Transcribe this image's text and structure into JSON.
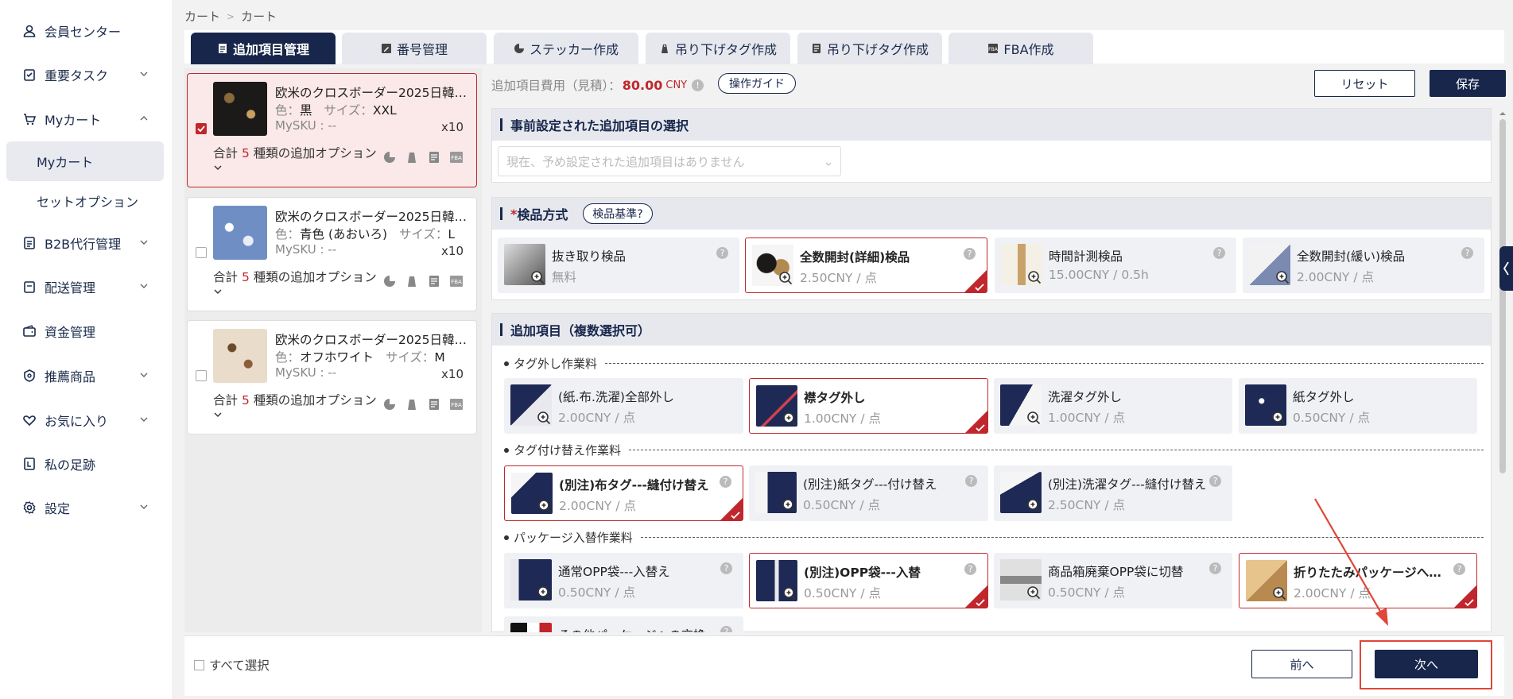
{
  "sidebar": {
    "items": [
      {
        "label": "会員センター",
        "icon": "user-icon",
        "chevron": false
      },
      {
        "label": "重要タスク",
        "icon": "task-icon",
        "chevron": true
      },
      {
        "label": "Myカート",
        "icon": "cart-icon",
        "chevron": true
      },
      {
        "label": "B2B代行管理",
        "icon": "document-icon",
        "chevron": true
      },
      {
        "label": "配送管理",
        "icon": "delivery-icon",
        "chevron": true
      },
      {
        "label": "資金管理",
        "icon": "wallet-icon",
        "chevron": false
      },
      {
        "label": "推薦商品",
        "icon": "recommend-icon",
        "chevron": true
      },
      {
        "label": "お気に入り",
        "icon": "heart-icon",
        "chevron": true
      },
      {
        "label": "私の足跡",
        "icon": "footprint-icon",
        "chevron": false
      },
      {
        "label": "設定",
        "icon": "gear-icon",
        "chevron": true
      }
    ],
    "subitems": [
      {
        "label": "Myカート",
        "active": true
      },
      {
        "label": "セットオプション",
        "active": false
      }
    ]
  },
  "breadcrumb": {
    "root": "カート",
    "current": "カート",
    "separator": ">"
  },
  "tabs": [
    {
      "label": "追加項目管理",
      "active": true
    },
    {
      "label": "番号管理",
      "active": false
    },
    {
      "label": "ステッカー作成",
      "active": false
    },
    {
      "label": "吊り下げタグ作成",
      "active": false
    },
    {
      "label": "吊り下げタグ作成",
      "active": false
    },
    {
      "label": "FBA作成",
      "active": false
    }
  ],
  "products": [
    {
      "title": "欧米のクロスボーダー2025日韓…",
      "color_label": "色：",
      "color": "黒",
      "size_label": "サイズ：",
      "size": "XXL",
      "sku": "MySKU : --",
      "qty": "x10",
      "options_prefix": "合計",
      "options_count": "5",
      "options_suffix": "種類の追加オプション",
      "checked": true
    },
    {
      "title": "欧米のクロスボーダー2025日韓…",
      "color_label": "色：",
      "color": "青色 (あおいろ)",
      "size_label": "サイズ：",
      "size": "L",
      "sku": "MySKU : --",
      "qty": "x10",
      "options_prefix": "合計",
      "options_count": "5",
      "options_suffix": "種類の追加オプション",
      "checked": false
    },
    {
      "title": "欧米のクロスボーダー2025日韓…",
      "color_label": "色：",
      "color": "オフホワイト",
      "size_label": "サイズ：",
      "size": "M",
      "sku": "MySKU : --",
      "qty": "x10",
      "options_prefix": "合計",
      "options_count": "5",
      "options_suffix": "種類の追加オプション",
      "checked": false
    }
  ],
  "fee": {
    "label": "追加項目費用（見積）：",
    "amount": "80.00",
    "currency": "CNY",
    "guide": "操作ガイド"
  },
  "actions": {
    "reset": "リセット",
    "save": "保存",
    "prev": "前へ",
    "next": "次へ",
    "select_all": "すべて選択"
  },
  "preset": {
    "title": "事前設定された追加項目の選択",
    "placeholder": "現在、予め設定された追加項目はありません"
  },
  "inspection": {
    "title": "検品方式",
    "required_mark": "*",
    "standard_btn": "検品基準?",
    "options": [
      {
        "name": "抜き取り検品",
        "price": "無料",
        "selected": false
      },
      {
        "name": "全数開封(詳細)検品",
        "price": "2.50CNY / 点",
        "selected": true
      },
      {
        "name": "時間計測検品",
        "price": "15.00CNY / 0.5h",
        "selected": false
      },
      {
        "name": "全数開封(緩い)検品",
        "price": "2.00CNY / 点",
        "selected": false
      }
    ]
  },
  "additional": {
    "title": "追加項目（複数選択可）",
    "groups": [
      {
        "label": "タグ外し作業料",
        "items": [
          {
            "name": "(紙.布.洗濯)全部外し",
            "price": "2.00CNY / 点",
            "selected": false
          },
          {
            "name": "襟タグ外し",
            "price": "1.00CNY / 点",
            "selected": true
          },
          {
            "name": "洗濯タグ外し",
            "price": "1.00CNY / 点",
            "selected": false
          },
          {
            "name": "紙タグ外し",
            "price": "0.50CNY / 点",
            "selected": false
          }
        ]
      },
      {
        "label": "タグ付け替え作業料",
        "items": [
          {
            "name": "(別注)布タグ---縫付け替え",
            "price": "2.00CNY / 点",
            "selected": true
          },
          {
            "name": "(別注)紙タグ---付け替え",
            "price": "0.50CNY / 点",
            "selected": false
          },
          {
            "name": "(別注)洗濯タグ---縫付け替え",
            "price": "2.50CNY / 点",
            "selected": false
          }
        ]
      },
      {
        "label": "パッケージ入替作業料",
        "items": [
          {
            "name": "通常OPP袋---入替え",
            "price": "0.50CNY / 点",
            "selected": false
          },
          {
            "name": "(別注)OPP袋---入替",
            "price": "0.50CNY / 点",
            "selected": true
          },
          {
            "name": "商品箱廃棄OPP袋に切替",
            "price": "0.50CNY / 点",
            "selected": false
          },
          {
            "name": "折りたたみパッケージへ…",
            "price": "2.00CNY / 点",
            "selected": true
          },
          {
            "name": "その他パッケージへの交換",
            "price": "",
            "selected": false
          }
        ]
      }
    ]
  },
  "colors": {
    "primary": "#17264a",
    "accent": "#c0272d",
    "annotation": "#e0463a"
  }
}
